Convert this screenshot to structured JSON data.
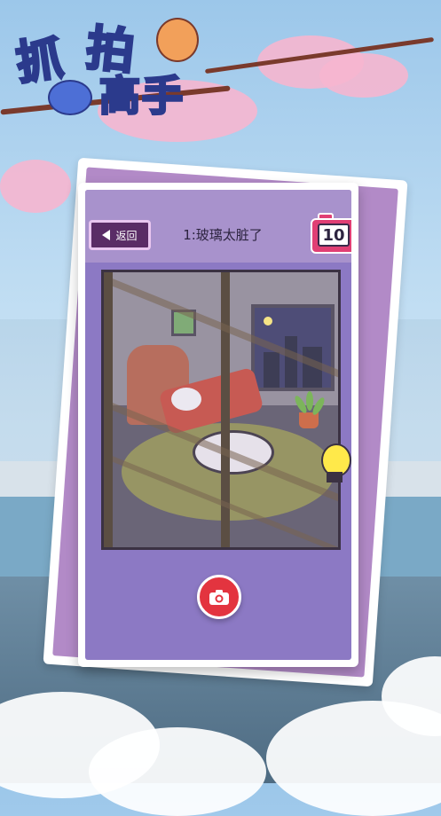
{
  "logo": {
    "line1": [
      "抓",
      "拍"
    ],
    "line2": "高手"
  },
  "header": {
    "back_label": "返回",
    "level_title": "1:玻璃太脏了",
    "shots_remaining": "10"
  },
  "icons": {
    "back": "back-arrow-icon",
    "counter": "camera-counter-icon",
    "shutter": "camera-icon",
    "helper": "lightbulb-icon"
  },
  "colors": {
    "card_purple": "#8c79c4",
    "back_button": "#5a2c66",
    "shutter_red": "#e3343f",
    "counter_pink": "#e03f74"
  }
}
